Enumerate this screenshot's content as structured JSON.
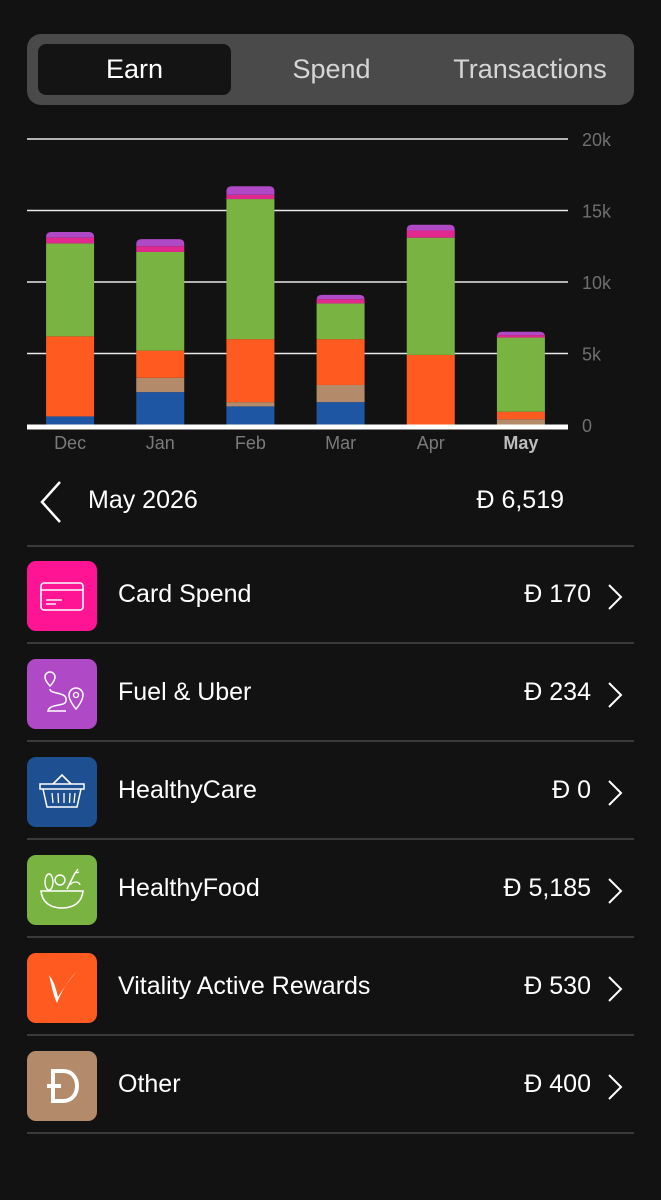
{
  "tabs": {
    "earn": "Earn",
    "spend": "Spend",
    "transactions": "Transactions"
  },
  "chart_data": {
    "type": "bar",
    "stacked": true,
    "categories": [
      "Dec",
      "Jan",
      "Feb",
      "Mar",
      "Apr",
      "May"
    ],
    "selected_category": "May",
    "y_ticks": [
      "20k",
      "15k",
      "10k",
      "5k",
      "0"
    ],
    "ylim": [
      0,
      20000
    ],
    "grid": true,
    "series": [
      {
        "color": "#1f56a3",
        "values": [
          600,
          2300,
          1300,
          1600,
          0,
          0
        ]
      },
      {
        "color": "#b38a6a",
        "values": [
          0,
          1000,
          300,
          1200,
          0,
          400
        ]
      },
      {
        "color": "#ff5a1f",
        "values": [
          5600,
          1900,
          4400,
          3200,
          4900,
          530
        ]
      },
      {
        "color": "#79b442",
        "values": [
          6500,
          6900,
          9800,
          2500,
          8200,
          5185
        ]
      },
      {
        "color": "#e0288e",
        "values": [
          400,
          400,
          300,
          300,
          500,
          170
        ]
      },
      {
        "color": "#b049c6",
        "values": [
          400,
          500,
          600,
          300,
          400,
          234
        ]
      }
    ]
  },
  "summary": {
    "month": "May 2026",
    "total": "Ð 6,519"
  },
  "items": [
    {
      "label": "Card Spend",
      "value": "Ð 170",
      "icon": "card-icon",
      "color": "#ff1493"
    },
    {
      "label": "Fuel & Uber",
      "value": "Ð 234",
      "icon": "route-icon",
      "color": "#b049c6"
    },
    {
      "label": "HealthyCare",
      "value": "Ð 0",
      "icon": "basket-icon",
      "color": "#1d4f91"
    },
    {
      "label": "HealthyFood",
      "value": "Ð 5,185",
      "icon": "food-bowl-icon",
      "color": "#79b442"
    },
    {
      "label": "Vitality Active Rewards",
      "value": "Ð 530",
      "icon": "vitality-icon",
      "color": "#ff5a1f"
    },
    {
      "label": "Other",
      "value": "Ð 400",
      "icon": "discovery-miles-icon",
      "color": "#b38a6a"
    }
  ]
}
